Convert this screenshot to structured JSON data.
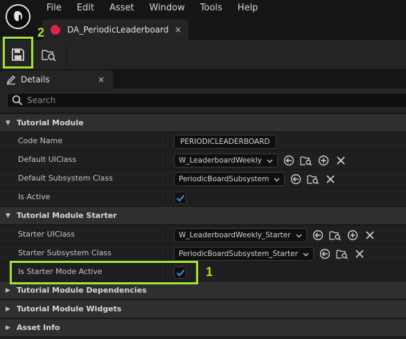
{
  "menu": [
    "File",
    "Edit",
    "Asset",
    "Window",
    "Tools",
    "Help"
  ],
  "document_tab": {
    "label": "DA_PeriodicLeaderboard",
    "close": "×"
  },
  "panel": {
    "tab_label": "Details",
    "tab_close": "×",
    "search_placeholder": "Search"
  },
  "categories": {
    "tutorial_module": "Tutorial Module",
    "tutorial_module_starter": "Tutorial Module Starter",
    "dependencies": "Tutorial Module Dependencies",
    "widgets": "Tutorial Module Widgets",
    "asset_info": "Asset Info"
  },
  "tutorial_module": {
    "code_name": {
      "label": "Code Name",
      "value": "PERIODICLEADERBOARD"
    },
    "default_uiclass": {
      "label": "Default UIClass",
      "value": "W_LeaderboardWeekly"
    },
    "default_subsystem_class": {
      "label": "Default Subsystem Class",
      "value": "PeriodicBoardSubsystem"
    },
    "is_active": {
      "label": "Is Active",
      "checked": true
    }
  },
  "tutorial_module_starter": {
    "starter_uiclass": {
      "label": "Starter UIClass",
      "value": "W_LeaderboardWeekly_Starter"
    },
    "starter_subsystem_class": {
      "label": "Starter Subsystem Class",
      "value": "PeriodicBoardSubsystem_Starter"
    },
    "is_starter_mode_active": {
      "label": "Is Starter Mode Active",
      "checked": true
    }
  },
  "annotations": {
    "step1": "1",
    "step2": "2"
  },
  "colors": {
    "highlight": "#a3e635",
    "checkbox_blue": "#3b8bd9",
    "asset_tab_accent": "#e0234b"
  },
  "icons": [
    "ue-logo-icon",
    "save-icon",
    "browse-asset-icon",
    "details-icon",
    "search-icon",
    "use-selected-icon",
    "browse-icon",
    "add-icon",
    "clear-icon",
    "checkmark-icon"
  ]
}
